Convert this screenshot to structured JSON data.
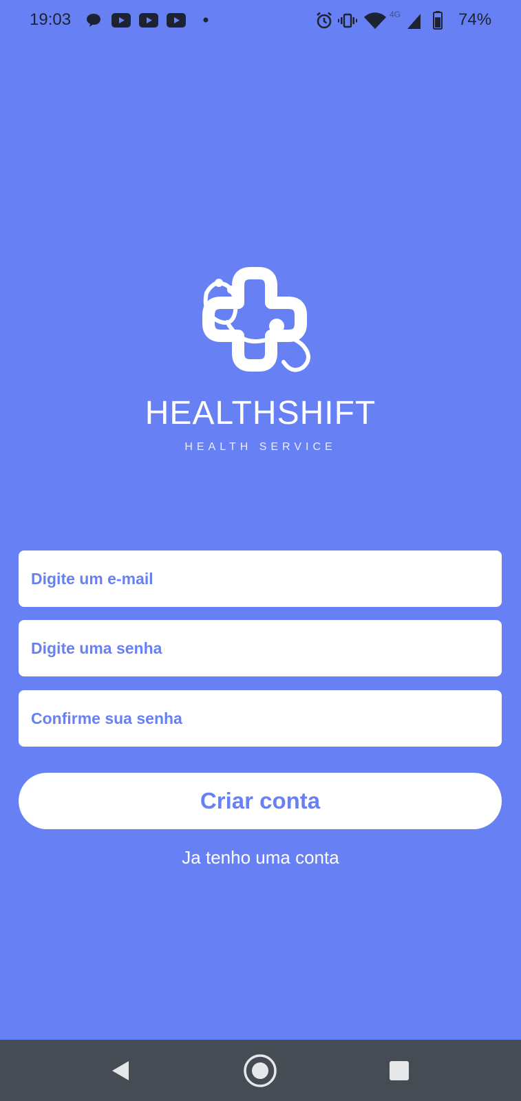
{
  "status_bar": {
    "time": "19:03",
    "network": "4G",
    "battery_percent": "74%",
    "battery_level": 0.74,
    "notification_icons": [
      "chat-bubble-icon",
      "youtube-icon",
      "youtube-icon",
      "youtube-icon",
      "dot-icon"
    ],
    "system_icons": [
      "alarm-icon",
      "vibrate-icon",
      "wifi-icon",
      "cellular-signal-icon",
      "battery-icon"
    ]
  },
  "brand": {
    "name": "HEALTHSHIFT",
    "tagline": "HEALTH SERVICE",
    "logo_icon": "cross-stethoscope-logo"
  },
  "form": {
    "email_placeholder": "Digite um e-mail",
    "password_placeholder": "Digite uma senha",
    "confirm_password_placeholder": "Confirme sua senha",
    "submit_label": "Criar conta",
    "login_link": "Ja tenho uma conta"
  },
  "nav_bar": {
    "buttons": [
      "back-icon",
      "home-icon",
      "recents-icon"
    ]
  },
  "colors": {
    "background": "#6781f5",
    "accent": "#6781f5",
    "surface": "#ffffff",
    "nav_bar": "#454c53",
    "status_text": "#1d2333"
  }
}
